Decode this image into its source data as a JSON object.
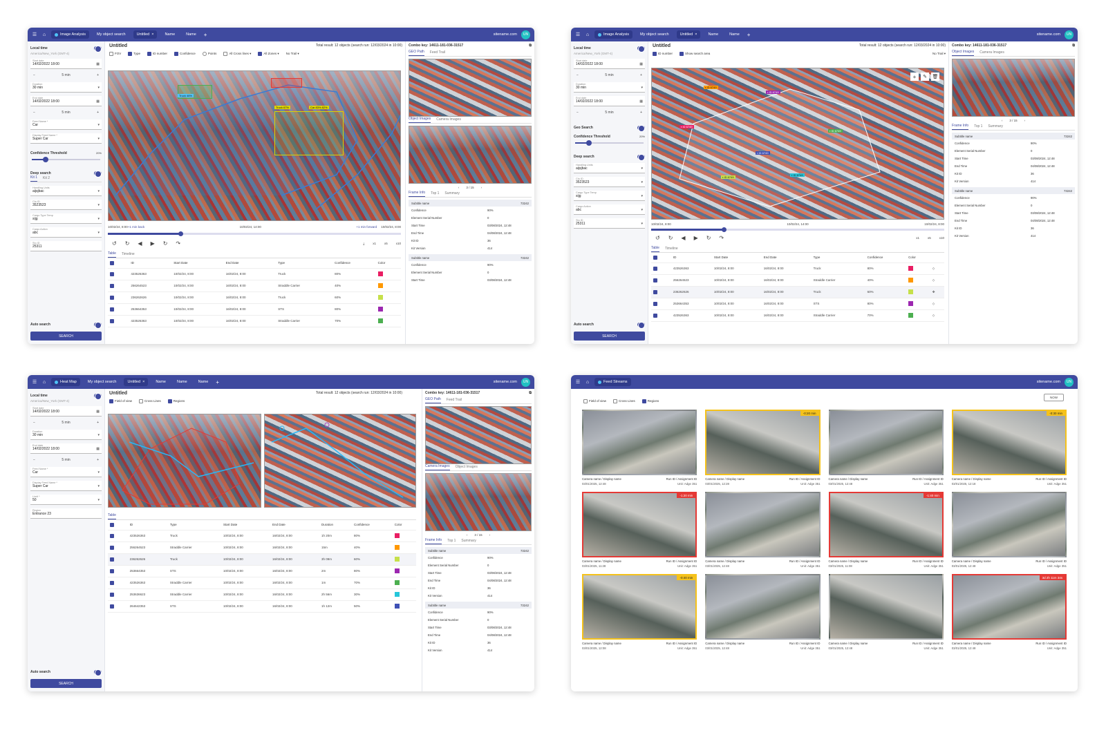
{
  "common": {
    "site": "sitename.com",
    "avatar": "UN",
    "tab_untitled": "Untitled",
    "tab_name": "Name",
    "tab_object_search": "My object search"
  },
  "w1": {
    "app": "Image Analysis",
    "title": "Untitled",
    "total": "Total result: 12 objects (search run: 12/03/2024 in 10:00)",
    "combo": "Combo key: 14611-181-036-31517",
    "filters": [
      "FOV",
      "Type",
      "ID number",
      "Confidence",
      "Points",
      "All Cross lines",
      "All Zones",
      "No Trail"
    ],
    "time_start": "10/02/24, 8:00",
    "back": "+1 min back",
    "time_mid": "10/02/24, 14:00",
    "fwd": "+1 min forward",
    "time_end": "10/02/24, 8:00",
    "speeds": [
      "x1",
      "x5",
      "x10"
    ],
    "labels": [
      "Truck 67%",
      "Car 83% 82%",
      "Truck 46%"
    ]
  },
  "w2": {
    "app": "Image Analysis",
    "title": "Untitled",
    "total": "Total result: 12 objects (search run: 12/03/2024 in 10:00)",
    "combo": "Combo key: 14611-181-036-31517",
    "filters": [
      "ID number",
      "Show search area",
      "No Trail"
    ],
    "time_start": "10/02/24, 8:00",
    "time_mid": "10/02/24, 14:00",
    "time_end": "10/02/24, 8:00"
  },
  "w3": {
    "app": "Heat Map",
    "title": "Untitled",
    "total": "Total result: 12 objects (search run: 12/03/2024 in 10:00)",
    "combo": "Combo key: 14611-181-036-31517",
    "filters": [
      "Field of view",
      "Cross Lines",
      "Regions"
    ]
  },
  "w4": {
    "app": "Feed Streams",
    "filters": [
      "Field of view",
      "Cross Lines",
      "Regions"
    ],
    "now": "NOW",
    "cells": [
      {
        "cam": "Camera name / Display name",
        "run": "Run ID / Assignment ID",
        "date": "03/01/2025, 12:48",
        "unit": "Unit: Adge 351",
        "tag": "",
        "border": ""
      },
      {
        "cam": "Camera name / Display name",
        "run": "Run ID / Assignment ID",
        "date": "03/01/2025, 12:28",
        "unit": "Unit: Adge 351",
        "tag": "-0:20 min",
        "border": "y"
      },
      {
        "cam": "Camera name / Display name",
        "run": "Run ID / Assignment ID",
        "date": "03/01/2025, 12:48",
        "unit": "Unit: Adge 351",
        "tag": "",
        "border": ""
      },
      {
        "cam": "Camera name / Display name",
        "run": "Run ID / Assignment ID",
        "date": "03/01/2025, 12:18",
        "unit": "Unit: Adge 351",
        "tag": "-0:30 min",
        "border": "y"
      },
      {
        "cam": "Camera name / Display name",
        "run": "Run ID / Assignment ID",
        "date": "03/01/2025, 11:28",
        "unit": "Unit: Adge 351",
        "tag": "-1:20 min",
        "border": "r"
      },
      {
        "cam": "Camera name / Display name",
        "run": "Run ID / Assignment ID",
        "date": "03/01/2025, 12:48",
        "unit": "Unit: Adge 351",
        "tag": "",
        "border": ""
      },
      {
        "cam": "Camera name / Display name",
        "run": "Run ID / Assignment ID",
        "date": "03/01/2025, 11:08",
        "unit": "Unit: Adge 351",
        "tag": "-1:40 min",
        "border": "r"
      },
      {
        "cam": "Camera name / Display name",
        "run": "Run ID / Assignment ID",
        "date": "03/01/2025, 12:48",
        "unit": "Unit: Adge 351",
        "tag": "",
        "border": ""
      },
      {
        "cam": "Camera name / Display name",
        "run": "Run ID / Assignment ID",
        "date": "03/01/2025, 12:08",
        "unit": "Unit: Adge 351",
        "tag": "-0:40 min",
        "border": "y"
      },
      {
        "cam": "Camera name / Display name",
        "run": "Run ID / Assignment ID",
        "date": "03/01/2025, 12:48",
        "unit": "Unit: Adge 351",
        "tag": "",
        "border": ""
      },
      {
        "cam": "Camera name / Display name",
        "run": "Run ID / Assignment ID",
        "date": "03/01/2025, 12:48",
        "unit": "Unit: Adge 351",
        "tag": "",
        "border": ""
      },
      {
        "cam": "Camera name / Display name",
        "run": "Run ID / Assignment ID",
        "date": "03/01/2025, 12:48",
        "unit": "Unit: Adge 351",
        "tag": "3d 2h 11m 34s",
        "border": "r"
      }
    ]
  },
  "sidebar": {
    "local_time": "Local time",
    "tz": "America/New_York (GMT-4)",
    "start_label": "Start date",
    "start": "14/02/2022 18:00",
    "step": "5 min",
    "duration_label": "Duration",
    "duration": "30 min",
    "end_label": "End date",
    "end": "14/02/2022 18:00",
    "feed_label": "Feed Name *",
    "feed": "Car",
    "display_label": "Display Feed Name *",
    "display": "Super Car",
    "conf": "Confidence Threshold",
    "conf_pct": "20%",
    "deep": "Deep search",
    "kit1": "Kit 1",
    "kit2": "Kit 2",
    "handling_label": "Handling Units",
    "handling": "aijsjbac",
    "cto_label": "Cto ID",
    "cto": "3523523",
    "cargo_type_label": "Cargo Type Temp",
    "cargo_type": "sijg",
    "cargo_action_label": "Cargo Action",
    "cargo_action": "abc",
    "sto_label": "Sto ID",
    "sto": "25311",
    "geo": "Geo Search",
    "limit_label": "Limit *",
    "limit": "50",
    "region_label": "Region",
    "region": "Entrance 23",
    "auto": "Auto search",
    "search": "SEARCH"
  },
  "right": {
    "geo_path": "GEO Path",
    "feed_trail": "Feed Trail",
    "object_images": "Object Images",
    "camera_images": "Camera Images",
    "pager": "3 / 15",
    "frame_info": "Frame Info",
    "top1": "Top 1",
    "summary": "Summary",
    "subtitle": "Subtitle name",
    "subtitle_val": "73242",
    "rows": [
      {
        "k": "Confidence",
        "v": "90%"
      },
      {
        "k": "Element Serial Number",
        "v": "0"
      },
      {
        "k": "Start Time",
        "v": "03/08/2024, 12:48"
      },
      {
        "k": "End Time",
        "v": "04/08/2024, 12:48"
      },
      {
        "k": "Kit ID",
        "v": "36"
      },
      {
        "k": "Kit Version",
        "v": "414"
      }
    ]
  },
  "table": {
    "tab_table": "Table",
    "tab_timeline": "Timeline",
    "headers": [
      "ID",
      "Start Date",
      "End Date",
      "Type",
      "Confidence",
      "Color"
    ],
    "rows": [
      {
        "id": "423526363",
        "start": "10/02/24, 8:00",
        "end": "16/02/24, 8:00",
        "type": "Truck",
        "conf": "80%",
        "color": "#e91e63"
      },
      {
        "id": "256264523",
        "start": "10/02/24, 8:00",
        "end": "16/02/24, 8:00",
        "type": "Straddle Carrier",
        "conf": "40%",
        "color": "#ff9800"
      },
      {
        "id": "236262626",
        "start": "10/02/24, 8:00",
        "end": "16/02/24, 8:00",
        "type": "Truck",
        "conf": "60%",
        "color": "#c6e04a"
      },
      {
        "id": "253664353",
        "start": "10/02/24, 8:00",
        "end": "16/02/24, 8:00",
        "type": "STS",
        "conf": "80%",
        "color": "#9c27b0"
      },
      {
        "id": "423526363",
        "start": "10/02/24, 8:00",
        "end": "16/02/24, 8:00",
        "type": "Straddle Carrier",
        "conf": "70%",
        "color": "#4caf50"
      }
    ]
  },
  "table3": {
    "headers": [
      "ID",
      "Type",
      "Start Date",
      "End Date",
      "Duration",
      "Confidence",
      "Color"
    ],
    "rows": [
      {
        "id": "423526363",
        "type": "Truck",
        "start": "10/02/24, 8:00",
        "end": "16/02/24, 8:00",
        "dur": "1h 20m",
        "conf": "80%",
        "color": "#e91e63"
      },
      {
        "id": "256264523",
        "type": "Straddle Carrier",
        "start": "10/02/24, 8:00",
        "end": "16/02/24, 8:00",
        "dur": "15m",
        "conf": "40%",
        "color": "#ff9800"
      },
      {
        "id": "236262626",
        "type": "Truck",
        "start": "10/02/24, 8:00",
        "end": "16/02/24, 8:00",
        "dur": "3h 09m",
        "conf": "60%",
        "color": "#c6e04a"
      },
      {
        "id": "253664353",
        "type": "STS",
        "start": "10/02/24, 8:00",
        "end": "16/02/24, 8:00",
        "dur": "2m",
        "conf": "80%",
        "color": "#9c27b0"
      },
      {
        "id": "423526363",
        "type": "Straddle Carrier",
        "start": "10/02/24, 8:00",
        "end": "16/02/24, 8:00",
        "dur": "1m",
        "conf": "70%",
        "color": "#4caf50"
      },
      {
        "id": "253636623",
        "type": "Straddle Carrier",
        "start": "10/02/24, 8:00",
        "end": "16/02/24, 8:00",
        "dur": "2h 56m",
        "conf": "30%",
        "color": "#26c6da"
      },
      {
        "id": "264642353",
        "type": "STS",
        "start": "10/02/24, 8:00",
        "end": "16/02/24, 8:00",
        "dur": "1h 12m",
        "conf": "50%",
        "color": "#3f51b5"
      }
    ]
  }
}
